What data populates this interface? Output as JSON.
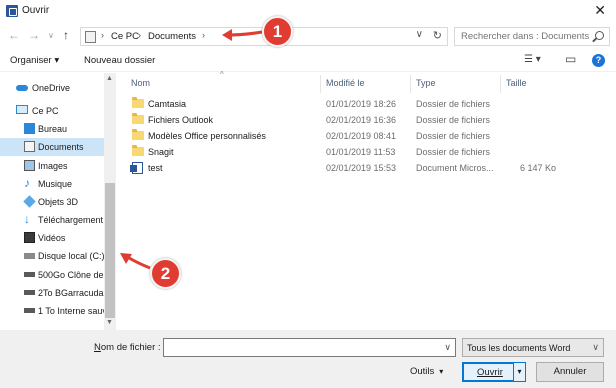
{
  "window": {
    "title": "Ouvrir",
    "close_glyph": "✕"
  },
  "nav": {
    "back_glyph": "←",
    "forward_glyph": "→",
    "down_glyph": "∨",
    "up_glyph": "↑",
    "breadcrumbs": [
      "Ce PC",
      "Documents"
    ],
    "separator": "›",
    "dropdown_glyph": "∨",
    "refresh_glyph": "↻",
    "search_placeholder": "Rechercher dans : Documents"
  },
  "toolbar": {
    "organize_label": "Organiser ▾",
    "new_folder_label": "Nouveau dossier",
    "view_glyph": "☰ ▾",
    "pane_glyph": "▭",
    "help_glyph": "?"
  },
  "sidebar": {
    "items": [
      {
        "label": "OneDrive",
        "icon": "cloud-icon"
      },
      {
        "label": "Ce PC",
        "icon": "computer-icon"
      },
      {
        "label": "Bureau",
        "icon": "desktop-icon"
      },
      {
        "label": "Documents",
        "icon": "documents-icon",
        "selected": true
      },
      {
        "label": "Images",
        "icon": "images-icon"
      },
      {
        "label": "Musique",
        "icon": "music-icon"
      },
      {
        "label": "Objets 3D",
        "icon": "3d-objects-icon"
      },
      {
        "label": "Téléchargement",
        "icon": "downloads-icon"
      },
      {
        "label": "Vidéos",
        "icon": "videos-icon"
      },
      {
        "label": "Disque local (C:)",
        "icon": "drive-icon"
      },
      {
        "label": "500Go Clône de",
        "icon": "drive-icon"
      },
      {
        "label": "2To BGarracuda",
        "icon": "drive-icon"
      },
      {
        "label": "1 To Interne sauv",
        "icon": "drive-icon"
      }
    ],
    "scroll_up": "▲",
    "scroll_down": "▼"
  },
  "columns": {
    "name": "Nom",
    "modified": "Modifié le",
    "type": "Type",
    "size": "Taille",
    "sort_glyph": "^"
  },
  "files": [
    {
      "name": "Camtasia",
      "modified": "01/01/2019 18:26",
      "type": "Dossier de fichiers",
      "size": "",
      "icon": "folder-icon"
    },
    {
      "name": "Fichiers Outlook",
      "modified": "02/01/2019 16:36",
      "type": "Dossier de fichiers",
      "size": "",
      "icon": "folder-icon"
    },
    {
      "name": "Modèles Office personnalisés",
      "modified": "02/01/2019 08:41",
      "type": "Dossier de fichiers",
      "size": "",
      "icon": "folder-icon"
    },
    {
      "name": "Snagit",
      "modified": "01/01/2019 11:53",
      "type": "Dossier de fichiers",
      "size": "",
      "icon": "folder-icon"
    },
    {
      "name": "test",
      "modified": "02/01/2019 15:53",
      "type": "Document Micros...",
      "size": "6 147 Ko",
      "icon": "word-doc-icon"
    }
  ],
  "footer": {
    "filename_label_u": "N",
    "filename_label_rest": "om de fichier :",
    "filename_value": "",
    "file_type": "Tous les documents Word",
    "tools_label": "Outils",
    "open_label": "Ouvrir",
    "cancel_label": "Annuler",
    "chevron": "∨"
  },
  "annotations": {
    "badge_1": "1",
    "badge_2": "2",
    "accent_color": "#e03c31"
  }
}
